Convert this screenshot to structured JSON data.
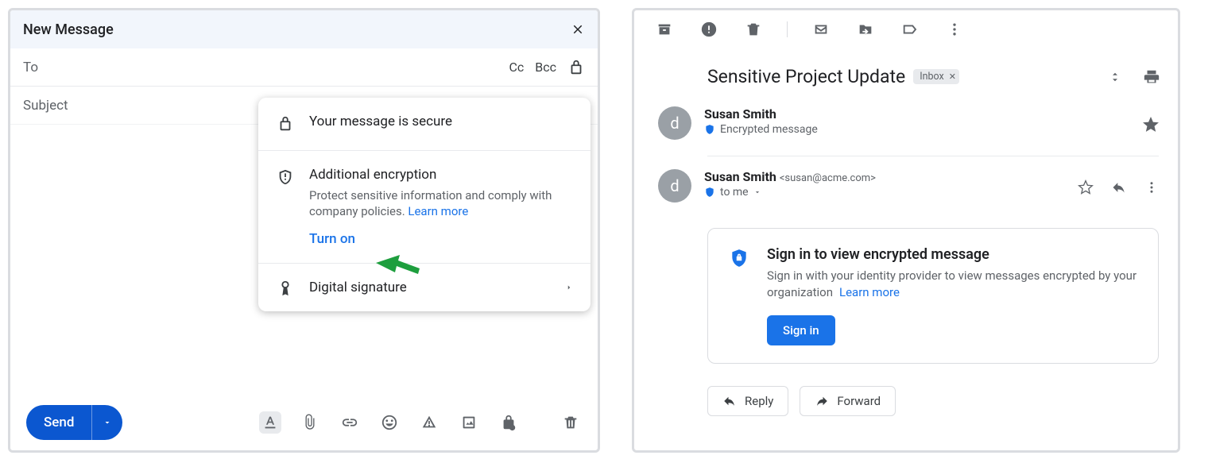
{
  "compose": {
    "title": "New Message",
    "to_label": "To",
    "cc": "Cc",
    "bcc": "Bcc",
    "subject_placeholder": "Subject",
    "send": "Send",
    "popover": {
      "secure_title": "Your message is secure",
      "enc_title": "Additional encryption",
      "enc_desc": "Protect sensitive information and comply with company policies. ",
      "learn_more": "Learn more",
      "turn_on": "Turn on",
      "dsig": "Digital signature"
    }
  },
  "read": {
    "subject": "Sensitive Project Update",
    "label": "Inbox",
    "msg1": {
      "avatar": "d",
      "sender": "Susan Smith",
      "sub": "Encrypted message"
    },
    "msg2": {
      "avatar": "d",
      "sender": "Susan Smith",
      "addr": "<susan@acme.com>",
      "to": "to me"
    },
    "enc": {
      "title": "Sign in to view encrypted message",
      "desc": "Sign in with your identity provider to view messages encrypted by your organization",
      "learn_more": "Learn  more",
      "signin": "Sign in"
    },
    "reply": "Reply",
    "forward": "Forward"
  }
}
